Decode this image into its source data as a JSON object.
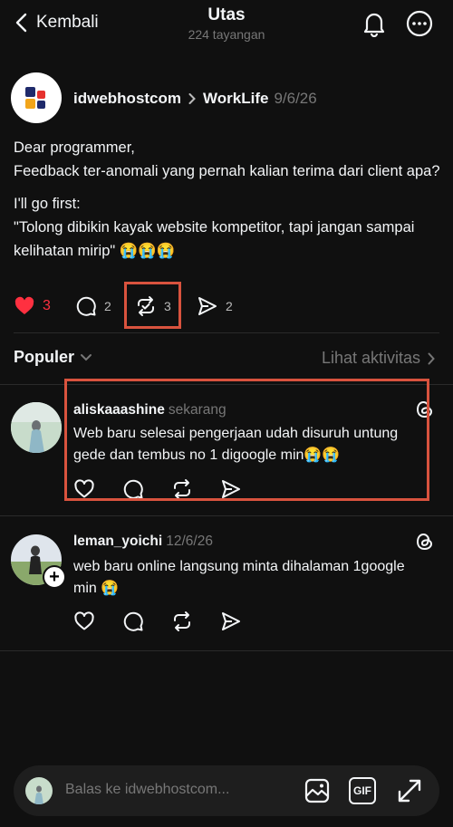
{
  "header": {
    "back_label": "Kembali",
    "title": "Utas",
    "views": "224 tayangan",
    "icons": [
      "chevron-left-icon",
      "bell-icon",
      "more-icon"
    ]
  },
  "post": {
    "username": "idwebhostcom",
    "topic": "WorkLife",
    "date": "9/6/26",
    "lines": [
      "Dear programmer,",
      "Feedback ter-anomali yang pernah kalian terima dari client apa?",
      "I'll go first:",
      "\"Tolong dibikin kayak website kompetitor, tapi jangan sampai kelihatan mirip\" 😭😭😭"
    ],
    "likes": "3",
    "replies": "2",
    "reposts": "3",
    "shares": "2"
  },
  "section": {
    "filter_label": "Populer",
    "activity_link": "Lihat aktivitas"
  },
  "replies": [
    {
      "username": "aliskaaashine",
      "time": "sekarang",
      "text": "Web baru selesai pengerjaan udah disuruh untung gede dan tembus no 1 digoogle min😭😭"
    },
    {
      "username": "leman_yoichi",
      "time": "12/6/26",
      "text": "web baru online langsung minta dihalaman 1google min 😭"
    }
  ],
  "composer": {
    "placeholder": "Balas ke idwebhostcom...",
    "gif_label": "GIF"
  },
  "colors": {
    "background": "#101010",
    "highlight_box": "#d9533e",
    "like_red": "#ff3040",
    "muted": "#777777"
  }
}
